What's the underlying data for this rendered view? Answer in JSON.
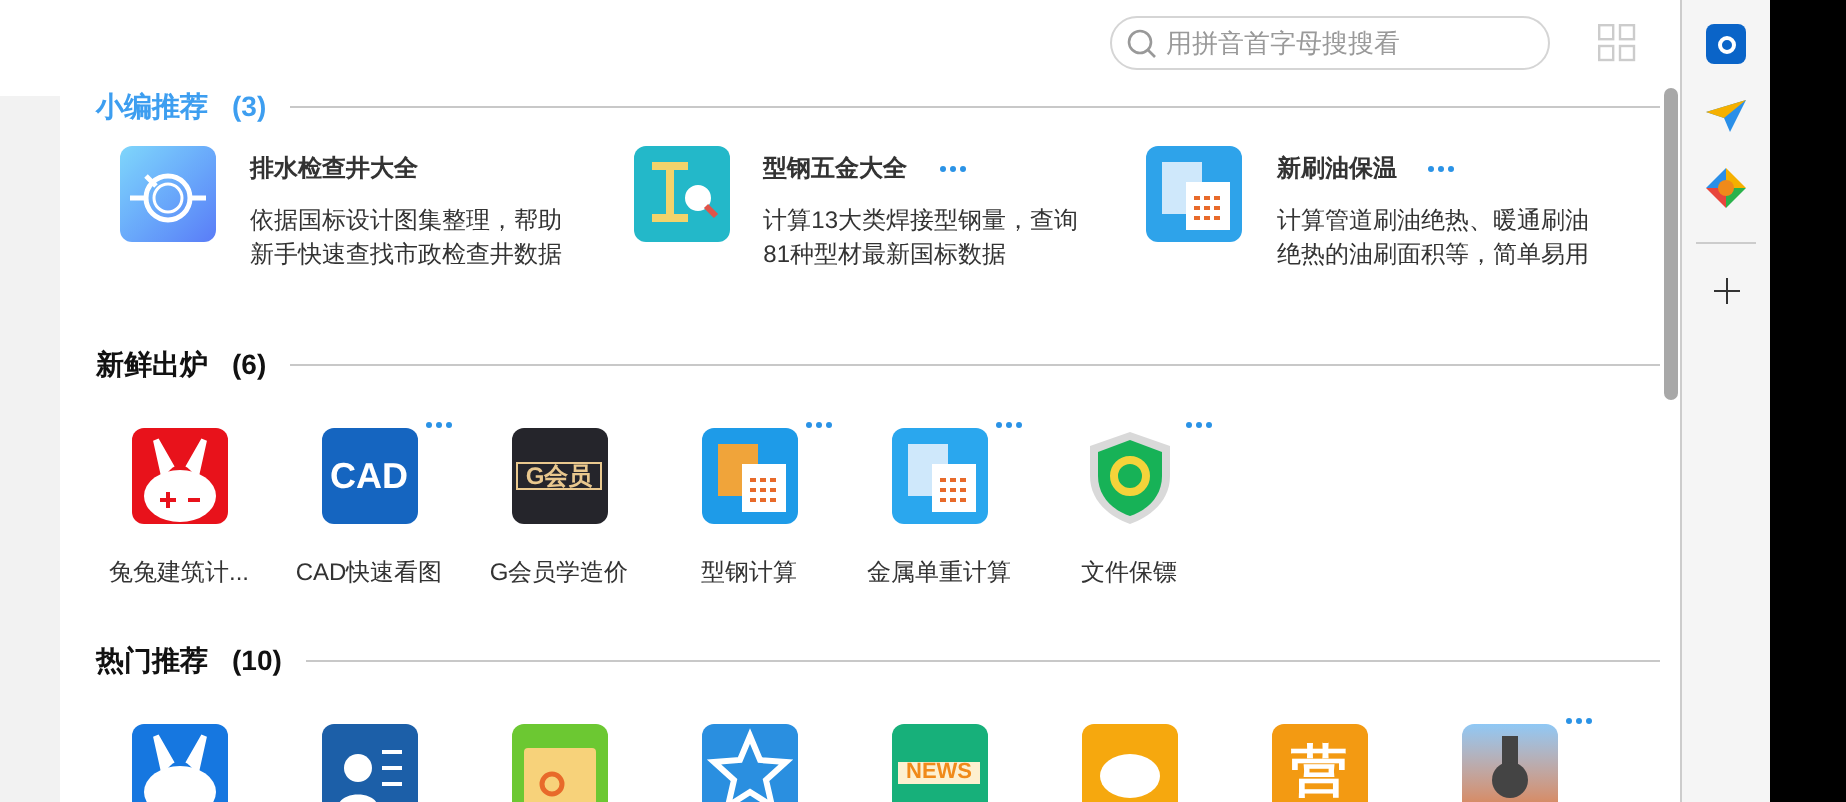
{
  "search": {
    "placeholder": "用拼音首字母搜搜看"
  },
  "sections": [
    {
      "title": "小编推荐",
      "count": "(3)",
      "highlight": true,
      "kind": "cards",
      "items": [
        {
          "kind": "manhole",
          "name": "排水检查井大全",
          "desc": "依据国标设计图集整理，帮助新手快速查找市政检查井数据",
          "more": false
        },
        {
          "kind": "book",
          "name": "型钢五金大全",
          "desc": "计算13大类焊接型钢量，查询81种型材最新国标数据",
          "more": true
        },
        {
          "kind": "grid",
          "name": "新刷油保温",
          "desc": "计算管道刷油绝热、暖通刷油绝热的油刷面积等，简单易用",
          "more": true
        }
      ]
    },
    {
      "title": "新鲜出炉",
      "count": "(6)",
      "highlight": false,
      "kind": "icons",
      "items": [
        {
          "kind": "rabbit",
          "name": "兔兔建筑计...",
          "more": false
        },
        {
          "kind": "cad",
          "name": "CAD快速看图",
          "badge": "CAD",
          "more": true
        },
        {
          "kind": "vip",
          "name": "G会员学造价",
          "badge": "G会员",
          "more": false
        },
        {
          "kind": "ruler",
          "name": "型钢计算",
          "more": true
        },
        {
          "kind": "calc",
          "name": "金属单重计算",
          "more": true
        },
        {
          "kind": "shield",
          "name": "文件保镖",
          "more": true
        }
      ]
    },
    {
      "title": "热门推荐",
      "count": "(10)",
      "highlight": false,
      "kind": "icons",
      "items": [
        {
          "kind": "pdf",
          "more": false
        },
        {
          "kind": "worker",
          "more": false
        },
        {
          "kind": "folder",
          "more": false
        },
        {
          "kind": "star",
          "more": false
        },
        {
          "kind": "news",
          "badge": "NEWS",
          "more": false
        },
        {
          "kind": "cloud",
          "more": false
        },
        {
          "kind": "ying",
          "badge": "营",
          "more": false
        },
        {
          "kind": "drill",
          "more": true
        }
      ]
    }
  ]
}
